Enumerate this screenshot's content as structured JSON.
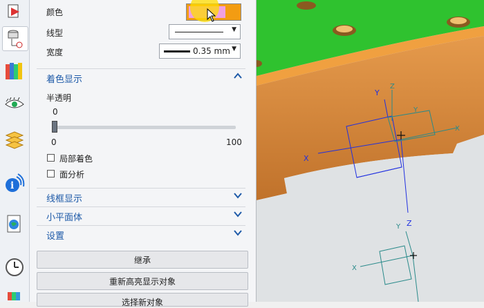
{
  "panel": {
    "color_label": "颜色",
    "color_swatch": "#f0a0e0",
    "color_accent": "#f39c12",
    "linetype_label": "线型",
    "width_label": "宽度",
    "width_value": "0.35 mm",
    "shading_section": "着色显示",
    "transparency_label": "半透明",
    "transparency_value": "0",
    "slider_min": "0",
    "slider_max": "100",
    "slider_level": 0,
    "partial_shading_label": "局部着色",
    "face_analysis_label": "面分析",
    "wireframe_section": "线框显示",
    "facet_section": "小平面体",
    "settings_section": "设置",
    "inherit_button": "继承",
    "rehighlight_button": "重新高亮显示对象",
    "select_new_button": "选择新对象"
  },
  "viewport": {
    "axes_upper": {
      "x": "X",
      "y": "Y",
      "z": "Z"
    },
    "axes_lower": {
      "x": "X",
      "y": "Y",
      "z": "Z"
    },
    "orange": "#d98a3a",
    "green": "#2fc22f"
  }
}
